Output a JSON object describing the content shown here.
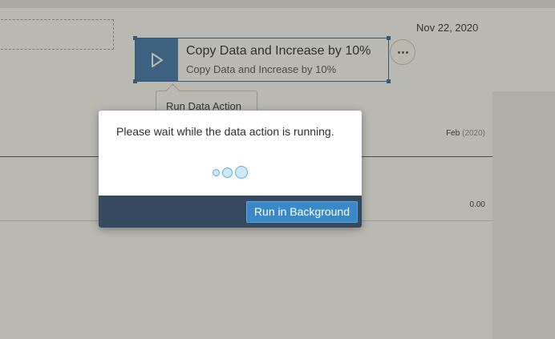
{
  "page": {
    "date": "Nov 22, 2020"
  },
  "widget": {
    "title": "Copy Data and Increase by 10%",
    "subtitle": "Copy Data and Increase by 10%",
    "play_icon": "play-icon",
    "more_icon": "more-options-icon",
    "accent_color": "#3e79b4"
  },
  "tooltip": {
    "text": "Run Data Action"
  },
  "table": {
    "column_header": {
      "month": "Feb",
      "year": "(2020)"
    },
    "cell_value": "0.00"
  },
  "dialog": {
    "message": "Please wait while the data action is running.",
    "busy_icon": "busy-indicator-icon",
    "button_label": "Run in Background",
    "footer_color": "#354a5f",
    "button_color": "#3a88c8"
  }
}
